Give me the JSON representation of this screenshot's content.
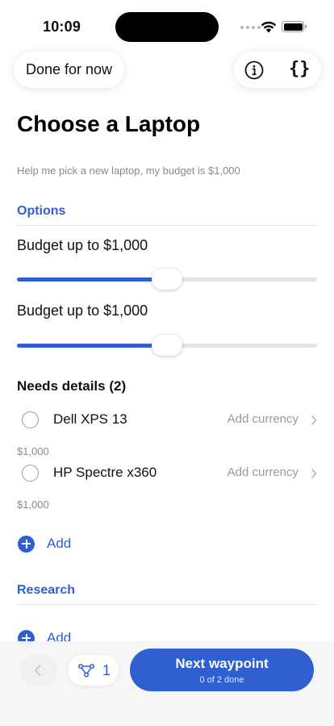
{
  "status_bar": {
    "time": "10:09"
  },
  "header": {
    "done_label": "Done for now",
    "info_icon": "info-circle-icon",
    "code_label": "{}"
  },
  "page": {
    "title": "Choose a Laptop",
    "subtitle": "Help me pick a new laptop, my budget is $1,000"
  },
  "options_section": {
    "header": "Options",
    "sliders": [
      {
        "label": "Budget up to $1,000",
        "level": 0.5
      },
      {
        "label": "Budget up to $1,000",
        "level": 0.5
      }
    ]
  },
  "needs_details": {
    "title": "Needs details (2)",
    "items": [
      {
        "name": "Dell XPS 13",
        "hint": "Add currency",
        "price": "$1,000"
      },
      {
        "name": "HP Spectre x360",
        "hint": "Add currency",
        "price": "$1,000"
      }
    ],
    "add_label": "Add"
  },
  "research_section": {
    "header": "Research",
    "add_label": "Add"
  },
  "bottom_bar": {
    "waypoint_count": "1",
    "next_label": "Next waypoint",
    "next_sub": "0 of 2 done"
  },
  "colors": {
    "accent": "#2f5fd0",
    "muted": "#8a8a8a"
  }
}
